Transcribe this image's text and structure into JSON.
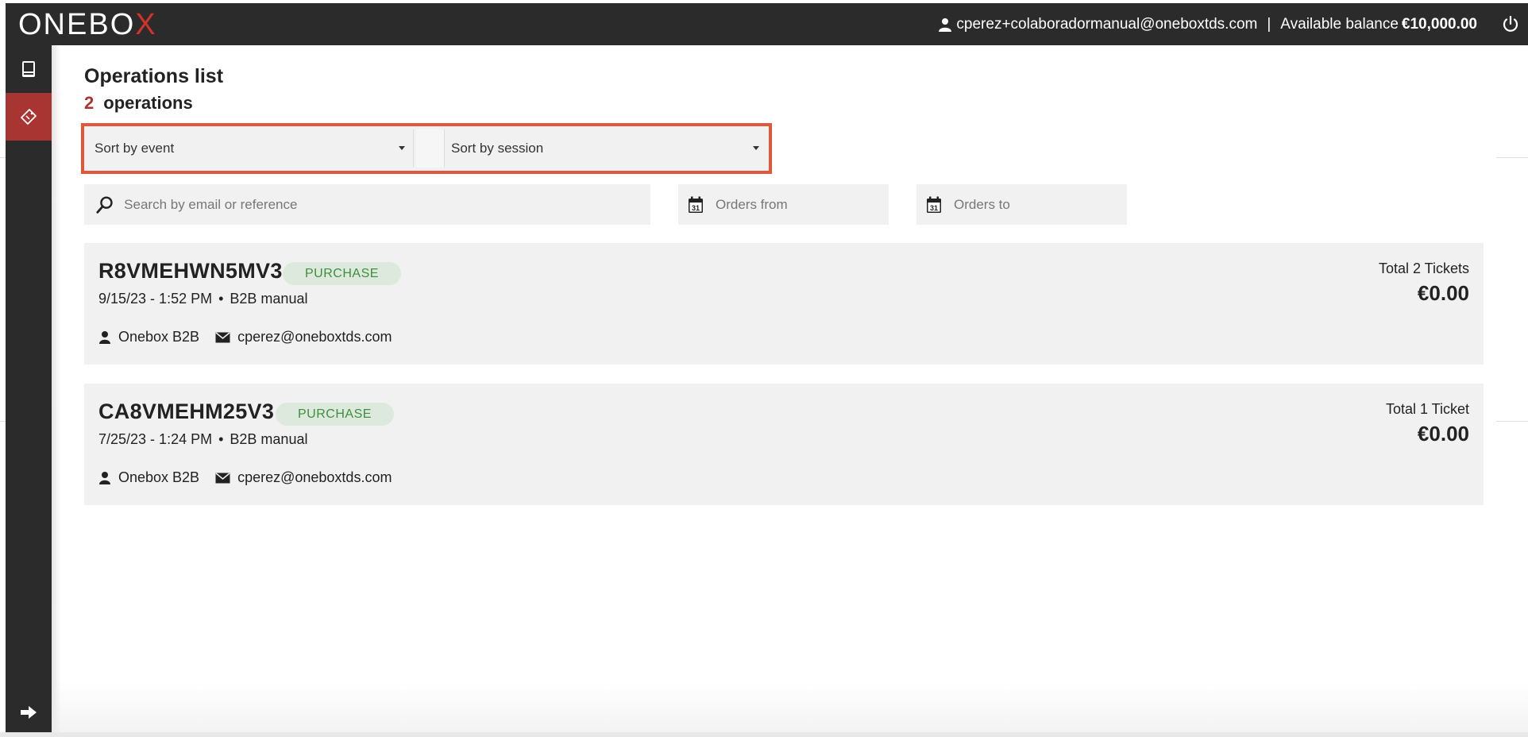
{
  "header": {
    "logo_main": "ONEBO",
    "logo_x": "X",
    "user_email": "cperez+colaboradormanual@oneboxtds.com",
    "separator": "|",
    "balance_label": "Available balance",
    "balance_value": "€10,000.00",
    "icons": {
      "user": "user-icon",
      "logout": "power-icon"
    }
  },
  "sidebar": {
    "items": [
      {
        "name": "sidebar-item-sales",
        "icon": "book-icon",
        "active": false
      },
      {
        "name": "sidebar-item-operations",
        "icon": "ticket-icon",
        "active": true
      }
    ],
    "bottom_icon": "arrow-right-icon"
  },
  "main": {
    "title": "Operations list",
    "count": "2",
    "count_label": "operations",
    "sort": {
      "event_label": "Sort by event",
      "session_label": "Sort by session"
    },
    "filters": {
      "search_placeholder": "Search by email or reference",
      "date_from_placeholder": "Orders from",
      "date_to_placeholder": "Orders to",
      "calendar_day": "31"
    },
    "operations": [
      {
        "reference": "R8VMEHWN5MV3",
        "type": "PURCHASE",
        "datetime": "9/15/23 - 1:52 PM",
        "bullet": "•",
        "channel": "B2B manual",
        "client": "Onebox B2B",
        "email": "cperez@oneboxtds.com",
        "total_label": "Total 2 Tickets",
        "total_value": "€0.00"
      },
      {
        "reference": "CA8VMEHM25V3",
        "type": "PURCHASE",
        "datetime": "7/25/23 - 1:24 PM",
        "bullet": "•",
        "channel": "B2B manual",
        "client": "Onebox B2B",
        "email": "cperez@oneboxtds.com",
        "total_label": "Total 1 Ticket",
        "total_value": "€0.00"
      }
    ]
  },
  "colors": {
    "topbar": "#2b2b2b",
    "accent": "#a83531",
    "highlight_border": "#e0573b",
    "badge_bg": "#dde9dc",
    "badge_text": "#3e8e3e"
  }
}
